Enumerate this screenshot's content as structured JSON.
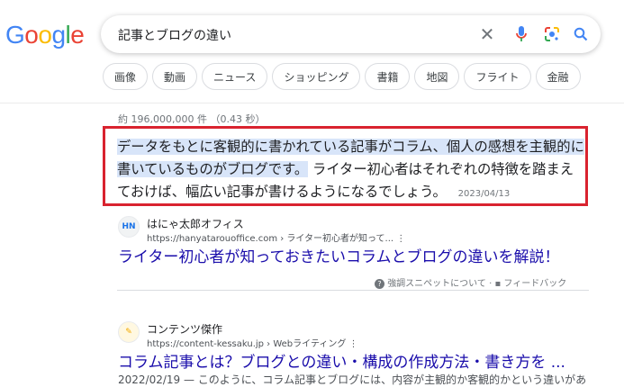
{
  "logo": {
    "text": "Google",
    "colors": [
      "#4285f4",
      "#ea4335",
      "#fbbc05",
      "#4285f4",
      "#34a853",
      "#ea4335"
    ]
  },
  "search": {
    "query": "記事とブログの違い"
  },
  "chips": [
    "画像",
    "動画",
    "ニュース",
    "ショッピング",
    "書籍",
    "地図",
    "フライト",
    "金融"
  ],
  "stats": "約 196,000,000 件 （0.43 秒）",
  "featured_snippet": {
    "highlighted_text": "データをもとに客観的に書かれている記事がコラム、個人の感想を主観的に書いているものがブログです。",
    "rest_text": "ライター初心者はそれぞれの特徴を踏まえておけば、幅広い記事が書けるようになるでしょう。",
    "date": "2023/04/13"
  },
  "results": [
    {
      "icon_text": "HN",
      "site": "はにゃ太郎オフィス",
      "url": "https://hanyatarouoffice.com › ライター初心者が知って...",
      "title": "ライター初心者が知っておきたいコラムとブログの違いを解説！"
    },
    {
      "icon_text": "✎",
      "site": "コンテンツ傑作",
      "url": "https://content-kessaku.jp › Webライティング",
      "title": "コラム記事とは？ブログとの違い・構成の作成方法・書き方を ...",
      "snippet": "2022/02/19 — このように、コラム記事とブログには、内容が主観的か客観的かという違いがあ"
    }
  ],
  "feedback": {
    "about": "強調スニペットについて",
    "feedback": "フィードバック"
  }
}
